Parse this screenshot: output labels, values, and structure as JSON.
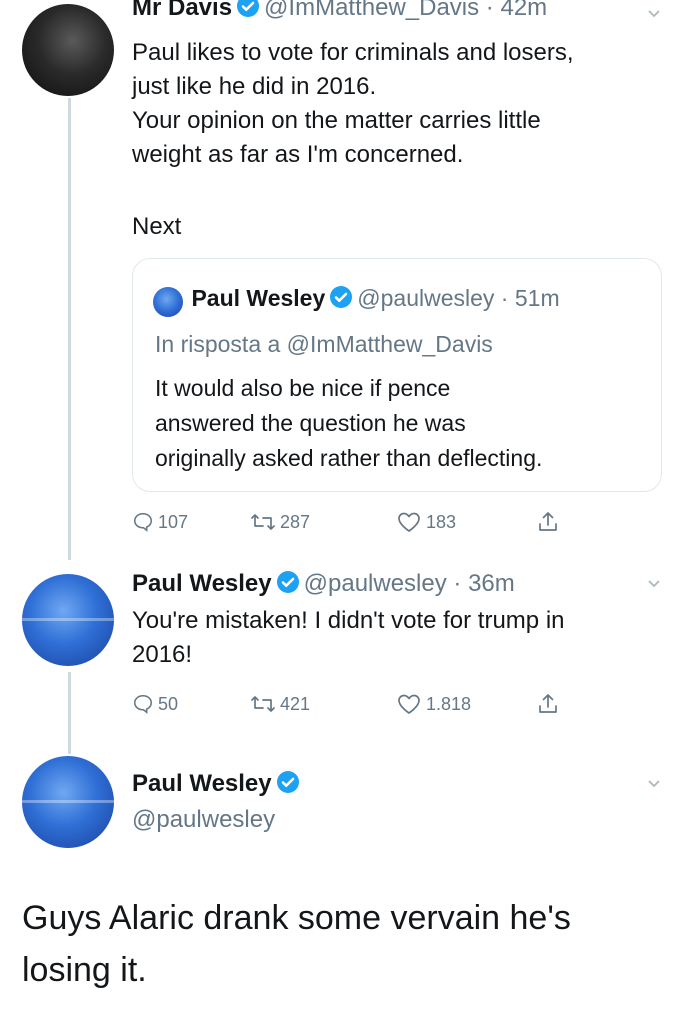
{
  "colors": {
    "verified_blue": "#1da1f2",
    "muted_text": "#657786",
    "primary_text": "#14171a",
    "thread_line": "#cfd9de"
  },
  "tweet1": {
    "name": "Mr Davis",
    "handle": "@ImMatthew_Davis",
    "time": "42m",
    "text_lines": [
      "Paul likes to vote for criminals and losers,",
      "just like he did in 2016.",
      "Your opinion on the matter carries little",
      "weight as far as I'm concerned."
    ],
    "next": "Next",
    "quote": {
      "name": "Paul Wesley",
      "handle": "@paulwesley",
      "time": "51m",
      "reply_to": "In risposta a @ImMatthew_Davis",
      "text_lines": [
        "It would also be nice if pence",
        "answered the question he was",
        "originally asked rather than deflecting."
      ]
    },
    "replies": "107",
    "retweets": "287",
    "likes": "183"
  },
  "tweet2": {
    "name": "Paul Wesley",
    "handle": "@paulwesley",
    "time": "36m",
    "text_lines": [
      "You're mistaken! I didn't vote for trump in",
      "2016!"
    ],
    "replies": "50",
    "retweets": "421",
    "likes": "1.818"
  },
  "profile": {
    "name": "Paul Wesley",
    "handle": "@paulwesley"
  },
  "caption": {
    "lines": [
      "Guys Alaric drank some vervain he's",
      "losing it."
    ]
  }
}
